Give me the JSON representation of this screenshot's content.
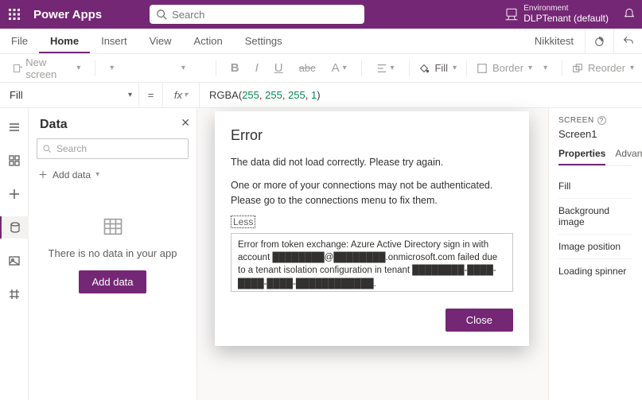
{
  "titlebar": {
    "app_name": "Power Apps",
    "search_placeholder": "Search",
    "environment_label": "Environment",
    "environment_name": "DLPTenant (default)"
  },
  "menubar": {
    "tabs": [
      "File",
      "Home",
      "Insert",
      "View",
      "Action",
      "Settings"
    ],
    "active_index": 1,
    "user": "Nikkitest"
  },
  "ribbon": {
    "new_screen": "New screen",
    "fill": "Fill",
    "border": "Border",
    "reorder": "Reorder"
  },
  "formula": {
    "property": "Fill",
    "fx": "fx",
    "fn": "RGBA",
    "args": [
      "255",
      "255",
      "255",
      "1"
    ]
  },
  "data_panel": {
    "title": "Data",
    "search_placeholder": "Search",
    "add_data": "Add data",
    "empty_text": "There is no data in your app",
    "add_button": "Add data"
  },
  "prop_panel": {
    "section": "SCREEN",
    "name": "Screen1",
    "tabs": [
      "Properties",
      "Advanced"
    ],
    "active_tab": 0,
    "rows": [
      "Fill",
      "Background image",
      "Image position",
      "Loading spinner"
    ]
  },
  "modal": {
    "title": "Error",
    "line1": "The data did not load correctly. Please try again.",
    "line2": "One or more of your connections may not be authenticated. Please go to the connections menu to fix them.",
    "toggle": "Less",
    "details": "Error from token exchange: Azure Active Directory sign in with account ████████@████████.onmicrosoft.com failed due to a tenant isolation configuration in tenant ████████-████-████-████-████████████.",
    "close": "Close"
  }
}
